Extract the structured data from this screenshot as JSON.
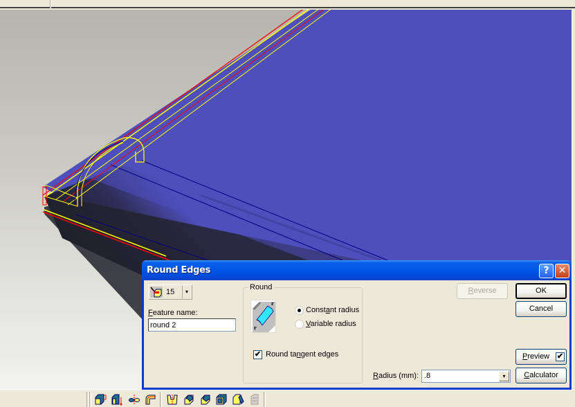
{
  "window": {
    "colors": {
      "face": "#ece9d8",
      "model_face": "#4e4fbd",
      "edge_highlight": "#ffff00",
      "edge_red": "#ff0000",
      "title_blue": "#0055e5"
    }
  },
  "dialog": {
    "title": "Round Edges",
    "help_label": "?",
    "close_label": "✕",
    "edge_picker": {
      "icon": "edge-select-icon",
      "count": "15",
      "dropdown": "▾"
    },
    "feature_name": {
      "label_accel": "F",
      "label_rest": "eature name:",
      "value": "round 2"
    },
    "round_group": {
      "legend": "Round",
      "illustration": "round-edge-illustration",
      "options": [
        {
          "pre": "Const",
          "accel": "a",
          "post": "nt radius",
          "checked": true
        },
        {
          "pre": "",
          "accel": "V",
          "post": "ariable radius",
          "checked": false
        }
      ],
      "tangent": {
        "pre": "Round ta",
        "accel": "n",
        "post": "gent edges",
        "checked": true,
        "mark": "✔"
      }
    },
    "buttons": {
      "reverse": {
        "accel": "R",
        "rest": "everse",
        "disabled": true
      },
      "ok": "OK",
      "cancel": "Cancel",
      "preview": {
        "accel": "P",
        "rest": "review",
        "checked": true,
        "mark": "✔"
      },
      "calculator": {
        "accel": "C",
        "rest": "alculator"
      }
    },
    "radius": {
      "label_accel": "R",
      "label_rest": "adius (mm):",
      "value": ".8",
      "dropdown": "▾"
    }
  },
  "toolbar": {
    "icons": [
      "extrude-feature-icon",
      "extrude-direction-icon",
      "revolve-axis-icon",
      "sweep-path-icon",
      "cut-feature-icon",
      "round-edge-icon",
      "chamfer-edge-icon",
      "shell-icon",
      "draft-icon",
      "disabled-feature-icon"
    ]
  }
}
